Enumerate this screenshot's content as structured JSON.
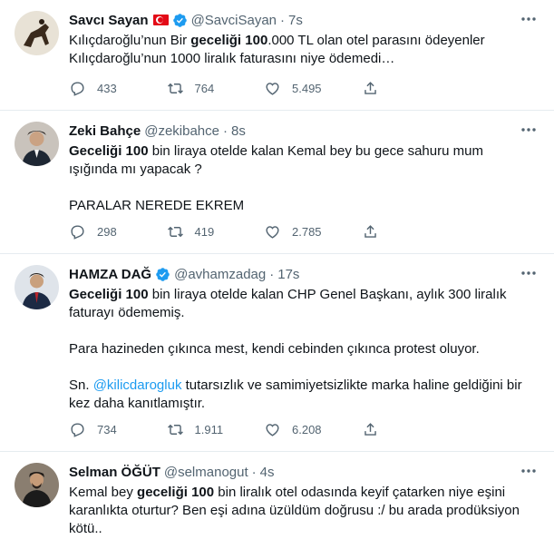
{
  "tweets": [
    {
      "name": "Savcı Sayan",
      "handle": "@SavciSayan",
      "dot": "·",
      "time": "7s",
      "text_parts": [
        "Kılıçdaroğlu’nun Bir ",
        "geceliği 100",
        ".000 TL olan otel parasını ödeyenler\nKılıçdaroğlu’nun 1000 liralık faturasını niye ödemedi…"
      ],
      "replies": "433",
      "retweets": "764",
      "likes": "5.495",
      "avatar_color": "#8b6a4a",
      "has_flag": true,
      "verified": true
    },
    {
      "name": "Zeki Bahçe",
      "handle": "@zekibahce",
      "dot": "·",
      "time": "8s",
      "text_parts": [
        "",
        "Geceliği 100",
        " bin liraya otelde kalan Kemal bey bu gece sahuru mum\nışığında mı yapacak ?\n\nPARALAR NEREDE EKREM"
      ],
      "replies": "298",
      "retweets": "419",
      "likes": "2.785",
      "avatar_color": "#3a4a5a",
      "has_flag": false,
      "verified": false
    },
    {
      "name": "HAMZA DAĞ",
      "handle": "@avhamzadag",
      "dot": "·",
      "time": "17s",
      "text_parts": [
        "",
        "Geceliği 100",
        " bin liraya otelde kalan CHP Genel Başkanı, aylık 300 liralık\nfaturayı ödememiş.\n\nPara hazineden çıkınca mest, kendi cebinden çıkınca protest oluyor.\n\nSn. "
      ],
      "mention": "@kilicdarogluk",
      "text_after_mention": " tutarsızlık ve samimiyetsizlikte marka haline geldiğini bir\nkez daha kanıtlamıştır.",
      "replies": "734",
      "retweets": "1.911",
      "likes": "6.208",
      "avatar_color": "#2f3e55",
      "has_flag": false,
      "verified": true
    },
    {
      "name": "Selman ÖĞÜT",
      "handle": "@selmanogut",
      "dot": "·",
      "time": "4s",
      "text_parts": [
        "Kemal bey ",
        "geceliği 100",
        " bin liralık otel odasında keyif çatarken niye eşini\nkaranlıkta oturtur? Ben eşi adına üzüldüm doğrusu :/ bu arada prodüksiyon\nkötü.."
      ],
      "avatar_color": "#5a4a3c",
      "has_flag": false,
      "verified": false
    }
  ],
  "colors": {
    "text": "#0f1419",
    "secondary": "#536471",
    "accent": "#1d9bf0",
    "border": "#e6ecf0"
  },
  "icons": [
    "reply-icon",
    "retweet-icon",
    "like-icon",
    "share-icon",
    "more-icon",
    "verified-icon",
    "turkish-flag-icon"
  ]
}
